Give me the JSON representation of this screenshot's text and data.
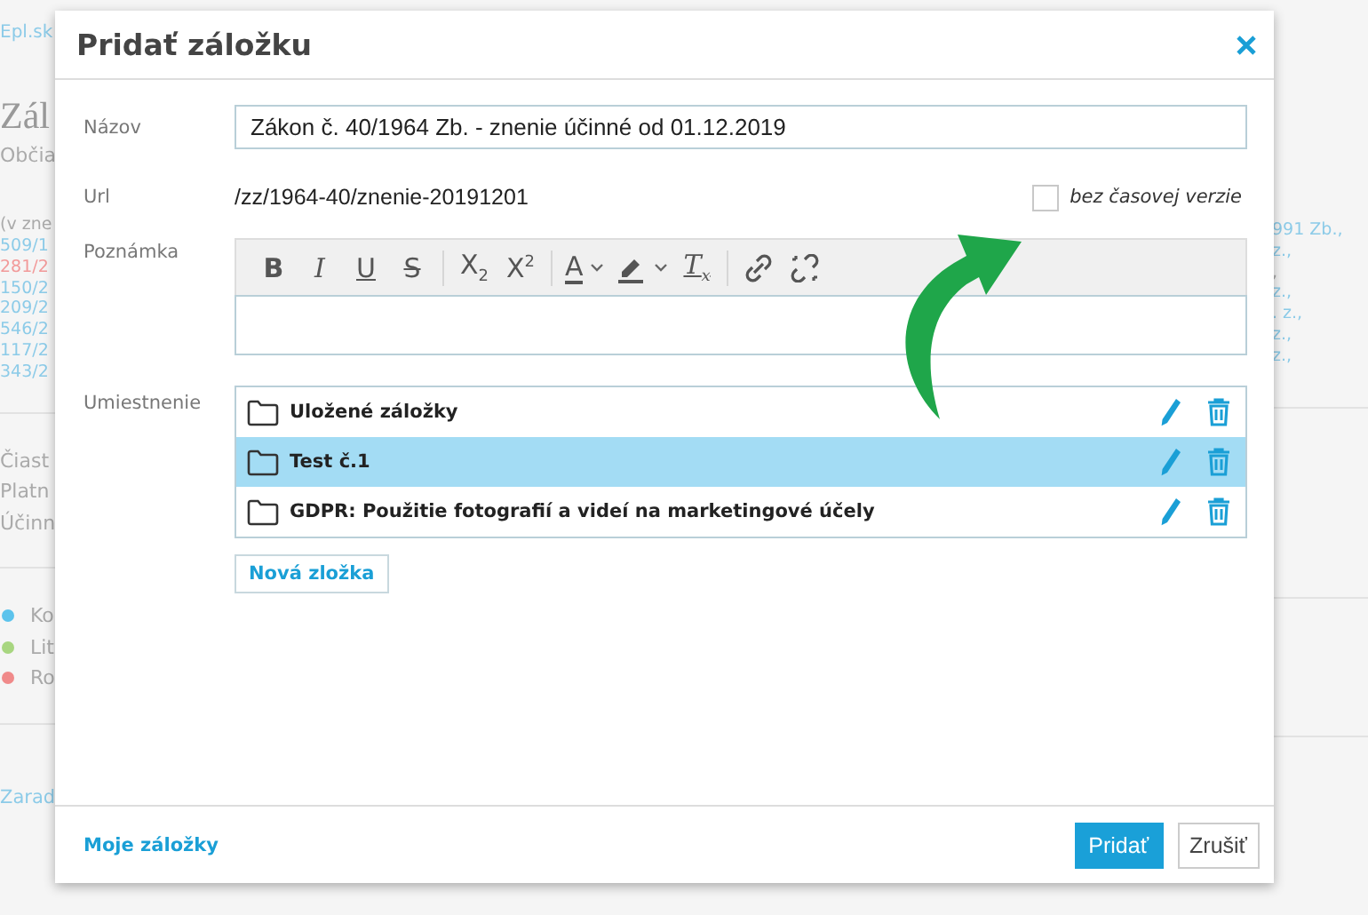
{
  "background": {
    "left": [
      {
        "kind": "link",
        "text": "Epl.sk"
      },
      {
        "kind": "heading",
        "text": "Zál"
      },
      {
        "kind": "subtitle",
        "text": "Občia"
      },
      {
        "kind": "note",
        "text": "(v zne"
      },
      {
        "kind": "ref",
        "text": "509/1",
        "color": "#8ccbe8"
      },
      {
        "kind": "ref",
        "text": "281/2",
        "color": "#f29a9a"
      },
      {
        "kind": "ref",
        "text": "150/2",
        "color": "#8ccbe8"
      },
      {
        "kind": "ref",
        "text": "209/2",
        "color": "#8ccbe8"
      },
      {
        "kind": "ref",
        "text": "546/2",
        "color": "#8ccbe8"
      },
      {
        "kind": "ref",
        "text": "117/2",
        "color": "#8ccbe8"
      },
      {
        "kind": "ref",
        "text": "343/2",
        "color": "#8ccbe8"
      },
      {
        "kind": "divider"
      },
      {
        "kind": "text",
        "text": "Čiast"
      },
      {
        "kind": "text",
        "text": "Platn"
      },
      {
        "kind": "text",
        "text": "Účinn"
      },
      {
        "kind": "divider"
      },
      {
        "kind": "legend",
        "text": "Ko",
        "color": "#5cc3ec"
      },
      {
        "kind": "legend",
        "text": "Lit",
        "color": "#a8d680"
      },
      {
        "kind": "legend",
        "text": "Ro",
        "color": "#f08a8a"
      },
      {
        "kind": "divider"
      },
      {
        "kind": "link",
        "text": "Zarad"
      }
    ],
    "right": [
      {
        "kind": "ref",
        "text": "991 Zb.,",
        "color": "#8ccbe8"
      },
      {
        "kind": "ref",
        "text": "z.,",
        "color": "#8ccbe8"
      },
      {
        "kind": "ref",
        "text": ","
      },
      {
        "kind": "ref",
        "text": "z.,",
        "color": "#8ccbe8"
      },
      {
        "kind": "ref",
        "text": ". z.,",
        "color": "#8ccbe8"
      },
      {
        "kind": "ref",
        "text": "z.,",
        "color": "#8ccbe8"
      },
      {
        "kind": "ref",
        "text": "z.,",
        "color": "#8ccbe8"
      },
      {
        "kind": "divider"
      },
      {
        "kind": "divider"
      },
      {
        "kind": "divider"
      }
    ]
  },
  "dialog": {
    "title": "Pridať záložku",
    "name": {
      "label": "Názov",
      "value": "Zákon č. 40/1964 Zb. - znenie účinné od 01.12.2019"
    },
    "url": {
      "label": "Url",
      "value": "/zz/1964-40/znenie-20191201"
    },
    "unversioned": {
      "label": "bez časovej verzie",
      "checked": false
    },
    "note": {
      "label": "Poznámka",
      "toolbar": [
        [
          {
            "kind": "bold",
            "label": "B"
          },
          {
            "kind": "italic",
            "label": "I"
          },
          {
            "kind": "underline",
            "label": "U"
          },
          {
            "kind": "strike",
            "label": "S"
          }
        ],
        [
          {
            "kind": "script",
            "label": "X$_{2}$"
          },
          {
            "kind": "script",
            "label": "X$^{2}$"
          }
        ],
        [
          {
            "kind": "color",
            "label": "A",
            "dropdown": true
          },
          {
            "kind": "highlight",
            "dropdown": true
          },
          {
            "kind": "clear",
            "label": "T$_{x}$"
          }
        ],
        [
          {
            "kind": "link"
          },
          {
            "kind": "unlink"
          }
        ]
      ]
    },
    "location": {
      "label": "Umiestnenie",
      "folders": [
        {
          "name": "Uložené záložky",
          "selected": false
        },
        {
          "name": "Test č.1",
          "selected": true
        },
        {
          "name": "GDPR: Použitie fotografií a videí na marketingové účely",
          "selected": false
        }
      ],
      "new_folder": "Nová zložka"
    },
    "footer": {
      "link": "Moje záložky",
      "primary": "Pridať",
      "cancel": "Zrušiť"
    }
  }
}
